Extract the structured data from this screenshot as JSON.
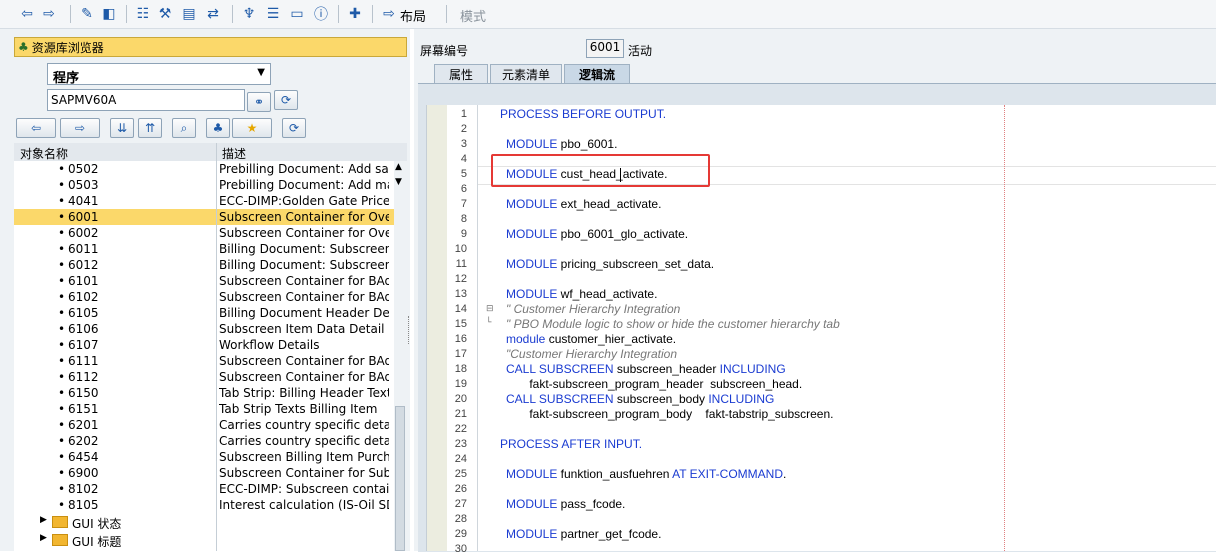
{
  "toolbar": {
    "layout_label": "布局",
    "mode_label": "模式",
    "icons": [
      "back-arrow-icon",
      "forward-arrow-icon",
      "edit-icon",
      "change-icon",
      "hierarchy-icon",
      "magic-wand-icon",
      "select-icon",
      "transfer-icon",
      "tree-icon",
      "align-icon",
      "screen-icon",
      "info-icon",
      "add-icon",
      "layout-arrow-icon"
    ]
  },
  "navigator": {
    "title": "资源库浏览器",
    "object_type": "程序",
    "object_name": "SAPMV60A",
    "col_object": "对象名称",
    "col_desc": "描述",
    "items": [
      {
        "no": "0502",
        "desc": "Prebilling Document: Add sales",
        "sel": false
      },
      {
        "no": "0503",
        "desc": "Prebilling Document: Add manu",
        "sel": false
      },
      {
        "no": "4041",
        "desc": "ECC-DIMP:Golden Gate Price Pr",
        "sel": false
      },
      {
        "no": "6001",
        "desc": "Subscreen Container for Overvi",
        "sel": true
      },
      {
        "no": "6002",
        "desc": "Subscreen Container for Overvi",
        "sel": false
      },
      {
        "no": "6011",
        "desc": "Billing Document: Subscreen, G",
        "sel": false
      },
      {
        "no": "6012",
        "desc": "Billing Document: Subscreen, G",
        "sel": false
      },
      {
        "no": "6101",
        "desc": "Subscreen Container for BAdI L",
        "sel": false
      },
      {
        "no": "6102",
        "desc": "Subscreen Container for BAdI L",
        "sel": false
      },
      {
        "no": "6105",
        "desc": "Billing Document Header Detail",
        "sel": false
      },
      {
        "no": "6106",
        "desc": "Subscreen Item Data Detail",
        "sel": false
      },
      {
        "no": "6107",
        "desc": "Workflow Details",
        "sel": false
      },
      {
        "no": "6111",
        "desc": "Subscreen Container for BAdI L",
        "sel": false
      },
      {
        "no": "6112",
        "desc": "Subscreen Container for BAdI L",
        "sel": false
      },
      {
        "no": "6150",
        "desc": "Tab Strip: Billing Header Texts",
        "sel": false
      },
      {
        "no": "6151",
        "desc": "Tab Strip Texts Billing Item",
        "sel": false
      },
      {
        "no": "6201",
        "desc": "Carries country specific detail sc",
        "sel": false
      },
      {
        "no": "6202",
        "desc": "Carries country specific detail sc",
        "sel": false
      },
      {
        "no": "6454",
        "desc": "Subscreen Billing Item Purchasir",
        "sel": false
      },
      {
        "no": "6900",
        "desc": "Subscreen Container for Subscr",
        "sel": false
      },
      {
        "no": "8102",
        "desc": "ECC-DIMP: Subscreen container",
        "sel": false
      },
      {
        "no": "8105",
        "desc": "Interest calculation (IS-Oil SDP",
        "sel": false
      }
    ],
    "folders": [
      "GUI 状态",
      "GUI 标题"
    ]
  },
  "screen": {
    "label": "屏幕编号",
    "number": "6001",
    "status": "活动",
    "tabs": [
      "属性",
      "元素清单",
      "逻辑流"
    ]
  },
  "code_lines": [
    "PROCESS BEFORE OUTPUT.",
    "",
    " MODULE pbo_6001.",
    "",
    " MODULE cust_head_activate.",
    "",
    " MODULE ext_head_activate.",
    "",
    " MODULE pbo_6001_glo_activate.",
    "",
    " MODULE pricing_subscreen_set_data.",
    "",
    " MODULE wf_head_activate.",
    "\" Customer Hierarchy Integration",
    "\" PBO Module logic to show or hide the customer hierarchy tab",
    " module customer_hier_activate.",
    "\"Customer Hierarchy Integration",
    " CALL SUBSCREEN subscreen_header INCLUDING",
    "        fakt-subscreen_program_header  subscreen_head.",
    " CALL SUBSCREEN subscreen_body INCLUDING",
    "        fakt-subscreen_program_body    fakt-tabstrip_subscreen.",
    "",
    "PROCESS AFTER INPUT.",
    "",
    " MODULE funktion_ausfuehren AT EXIT-COMMAND.",
    "",
    " MODULE pass_fcode.",
    "",
    " MODULE partner_get_fcode.",
    ""
  ],
  "line_numbers": [
    "1",
    "2",
    "3",
    "4",
    "5",
    "6",
    "7",
    "8",
    "9",
    "10",
    "11",
    "12",
    "13",
    "14",
    "15",
    "16",
    "17",
    "18",
    "19",
    "20",
    "21",
    "22",
    "23",
    "24",
    "25",
    "26",
    "27",
    "28",
    "29",
    "30"
  ],
  "colors": {
    "accent": "#1a3bd1",
    "selection": "#fbd86a",
    "highlight_box": "#e53935"
  }
}
